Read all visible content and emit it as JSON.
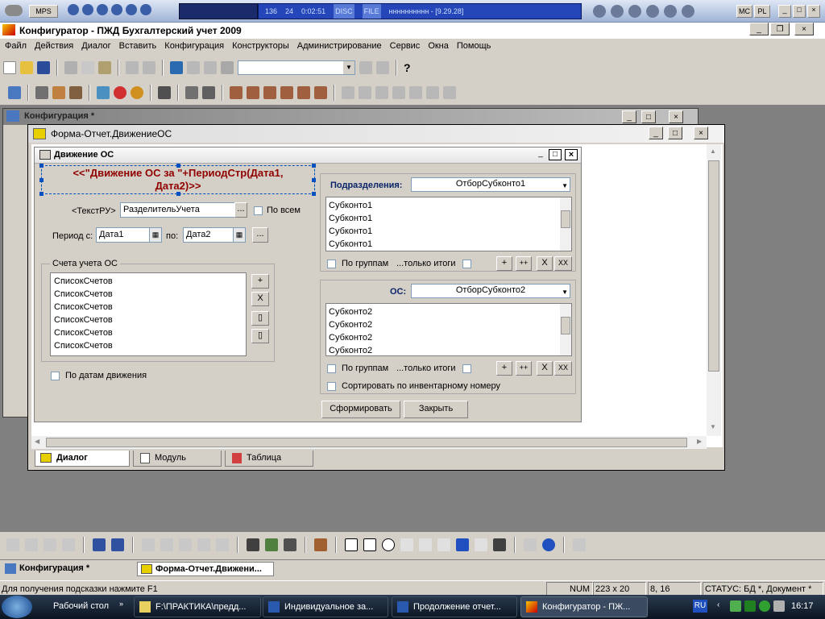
{
  "mediabar": {
    "buttons": [
      "MPS"
    ],
    "track": "136",
    "bitrate": "24",
    "time": "0:02:51",
    "info": "нннннннннн - [9.29.28]",
    "disc": "DISC",
    "file": "FILE",
    "mc": "MC",
    "pl": "PL"
  },
  "app": {
    "title": "Конфигуратор - ПЖД Бухгалтерский учет 2009",
    "menu": [
      "Файл",
      "Действия",
      "Диалог",
      "Вставить",
      "Конфигурация",
      "Конструкторы",
      "Администрирование",
      "Сервис",
      "Окна",
      "Помощь"
    ]
  },
  "config_window": {
    "title": "Конфигурация *"
  },
  "form_window": {
    "title": "Форма-Отчет.ДвижениеОС"
  },
  "dialog": {
    "title": "Движение ОС",
    "header_text_line1": "<<\"Движение ОС за \"+ПериодСтр(Дата1,",
    "header_text_line2": "Дата2)>>",
    "text_ru_label": "<ТекстРУ>",
    "separator_field": "РазделительУчета",
    "dots": "...",
    "all_label": "По всем",
    "period_from_label": "Период с:",
    "date1": "Дата1",
    "to_label": "по:",
    "date2": "Дата2",
    "accounts_group": "Счета учета ОС",
    "accounts_list": [
      "СписокСчетов",
      "СписокСчетов",
      "СписокСчетов",
      "СписокСчетов",
      "СписокСчетов",
      "СписокСчетов"
    ],
    "acc_btn_add": "+",
    "acc_btn_del": "X",
    "by_dates_label": "По датам движения",
    "divisions_label": "Подразделения:",
    "divisions_select": "ОтборСубконто1",
    "divisions_list": [
      "Субконто1",
      "Субконто1",
      "Субконто1",
      "Субконто1"
    ],
    "os_label": "ОС:",
    "os_select": "ОтборСубконто2",
    "os_list": [
      "Субконто2",
      "Субконто2",
      "Субконто2",
      "Субконто2"
    ],
    "by_groups_label": "По группам",
    "totals_only_label": "...только итоги",
    "btn_plus": "+",
    "btn_plusplus": "++",
    "btn_x": "X",
    "btn_xx": "XX",
    "sort_by_inv_label": "Сортировать по инвентарному номеру",
    "form_button": "Сформировать",
    "close_button": "Закрыть"
  },
  "editor_tabs": [
    "Диалог",
    "Модуль",
    "Таблица"
  ],
  "mdi_tabs": [
    "Конфигурация *",
    "Форма-Отчет.Движени..."
  ],
  "statusbar": {
    "hint": "Для получения подсказки нажмите F1",
    "num": "NUM",
    "size": "223 x 20",
    "pos": "8, 16",
    "status": "СТАТУС: БД *, Документ *"
  },
  "taskbar": {
    "desktop": "Рабочий стол",
    "items": [
      "F:\\ПРАКТИКА\\предд...",
      "Индивидуальное за...",
      "Продолжение отчет...",
      "Конфигуратор - ПЖ..."
    ],
    "lang": "RU",
    "clock": "16:17"
  }
}
